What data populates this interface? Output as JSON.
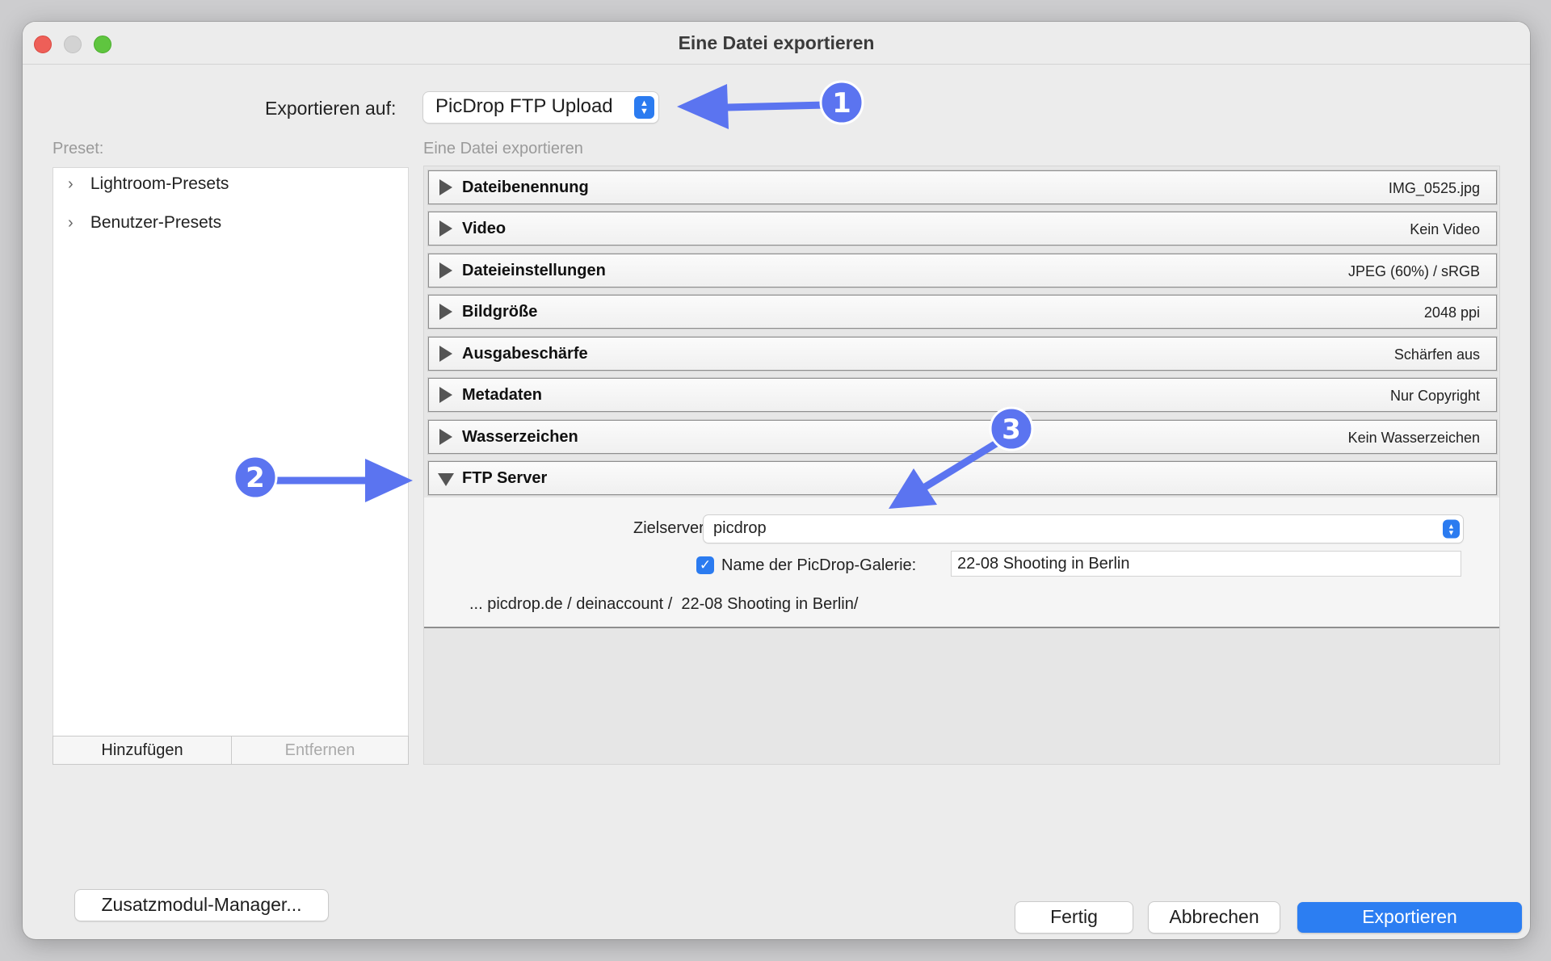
{
  "window": {
    "title": "Eine Datei exportieren"
  },
  "export_to": {
    "label": "Exportieren auf:",
    "value": "PicDrop FTP Upload"
  },
  "preset": {
    "label": "Preset:",
    "items": [
      {
        "label": "Lightroom-Presets"
      },
      {
        "label": "Benutzer-Presets"
      }
    ],
    "add_label": "Hinzufügen",
    "remove_label": "Entfernen"
  },
  "settings": {
    "label": "Eine Datei exportieren",
    "sections": [
      {
        "name": "Dateibenennung",
        "summary": "IMG_0525.jpg"
      },
      {
        "name": "Video",
        "summary": "Kein Video"
      },
      {
        "name": "Dateieinstellungen",
        "summary": "JPEG (60%) / sRGB"
      },
      {
        "name": "Bildgröße",
        "summary": "2048 ppi"
      },
      {
        "name": "Ausgabeschärfe",
        "summary": "Schärfen aus"
      },
      {
        "name": "Metadaten",
        "summary": "Nur Copyright"
      },
      {
        "name": "Wasserzeichen",
        "summary": "Kein Wasserzeichen"
      }
    ],
    "ftp": {
      "name": "FTP Server",
      "server_label": "Zielserver:",
      "server_value": "picdrop",
      "gallery_checkbox_label": "Name der PicDrop-Galerie:",
      "gallery_checked": true,
      "gallery_value": "22-08 Shooting in Berlin",
      "path_preview": "... picdrop.de / deinaccount /  22-08 Shooting in Berlin/"
    }
  },
  "footer": {
    "manager_label": "Zusatzmodul-Manager...",
    "done_label": "Fertig",
    "cancel_label": "Abbrechen",
    "export_label": "Exportieren"
  },
  "annotations": {
    "color": "#5b74f0",
    "badges": [
      "1",
      "2",
      "3"
    ]
  }
}
